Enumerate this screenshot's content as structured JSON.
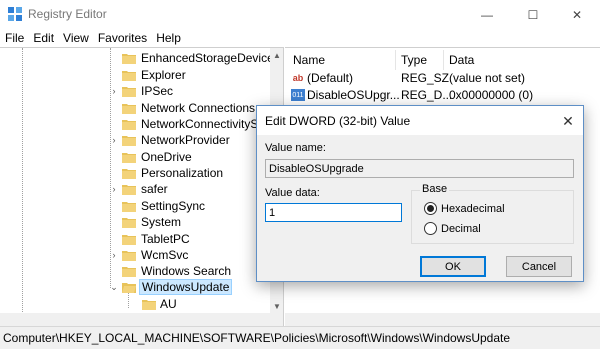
{
  "window": {
    "title": "Registry Editor",
    "min_glyph": "—",
    "max_glyph": "☐",
    "close_glyph": "✕"
  },
  "menu": [
    "File",
    "Edit",
    "View",
    "Favorites",
    "Help"
  ],
  "tree": {
    "items": [
      {
        "label": "EnhancedStorageDevices",
        "expander": ""
      },
      {
        "label": "Explorer",
        "expander": ""
      },
      {
        "label": "IPSec",
        "expander": "›"
      },
      {
        "label": "Network Connections",
        "expander": ""
      },
      {
        "label": "NetworkConnectivitySt",
        "expander": ""
      },
      {
        "label": "NetworkProvider",
        "expander": "›"
      },
      {
        "label": "OneDrive",
        "expander": ""
      },
      {
        "label": "Personalization",
        "expander": ""
      },
      {
        "label": "safer",
        "expander": "›"
      },
      {
        "label": "SettingSync",
        "expander": ""
      },
      {
        "label": "System",
        "expander": ""
      },
      {
        "label": "TabletPC",
        "expander": ""
      },
      {
        "label": "WcmSvc",
        "expander": "›"
      },
      {
        "label": "Windows Search",
        "expander": ""
      },
      {
        "label": "WindowsUpdate",
        "expander": "⌄"
      },
      {
        "label": "AU",
        "expander": ""
      }
    ],
    "selected": "WindowsUpdate",
    "scroll_up": "▲",
    "scroll_down": "▼"
  },
  "list": {
    "columns": [
      "Name",
      "Type",
      "Data"
    ],
    "rows": [
      {
        "icon": "ab",
        "name": "(Default)",
        "type": "REG_SZ",
        "data": "(value not set)"
      },
      {
        "icon": "011",
        "name": "DisableOSUpgr...",
        "type": "REG_D...",
        "data": "0x00000000 (0)"
      }
    ]
  },
  "statusbar": {
    "path": "Computer\\HKEY_LOCAL_MACHINE\\SOFTWARE\\Policies\\Microsoft\\Windows\\WindowsUpdate"
  },
  "dialog": {
    "title": "Edit DWORD (32-bit) Value",
    "close_glyph": "✕",
    "value_name_label": "Value name:",
    "value_name": "DisableOSUpgrade",
    "value_data_label": "Value data:",
    "value_data": "1",
    "base_label": "Base",
    "radio_hex": "Hexadecimal",
    "radio_dec": "Decimal",
    "base_selected": "Hexadecimal",
    "ok_label": "OK",
    "cancel_label": "Cancel"
  },
  "colors": {
    "selection_bg": "#cce8ff",
    "dialog_border": "#5e8fc6",
    "folder": "#e8c35a",
    "accent": "#0078d7"
  }
}
